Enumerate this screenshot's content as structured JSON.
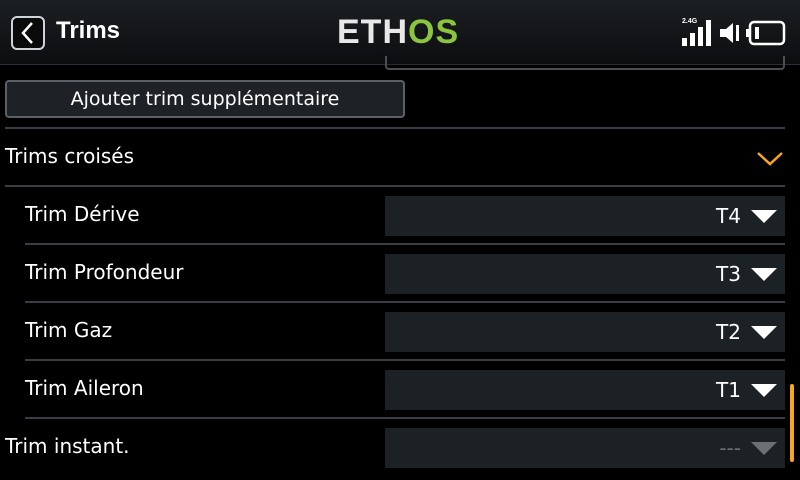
{
  "header": {
    "back_icon": "chevron-left-icon",
    "title": "Trims",
    "logo_left": "ETH",
    "logo_right": "OS",
    "signal_label": "2.4G",
    "icons": [
      "signal-bars-icon",
      "speaker-icon",
      "battery-icon"
    ]
  },
  "add_trim_label": "Ajouter trim supplémentaire",
  "cross_trims": {
    "title": "Trims croisés",
    "toggle_icon": "chevron-down-icon",
    "accent": "#f6a623",
    "rows": [
      {
        "label": "Trim Dérive",
        "value": "T4"
      },
      {
        "label": "Trim Profondeur",
        "value": "T3"
      },
      {
        "label": "Trim Gaz",
        "value": "T2"
      },
      {
        "label": "Trim Aileron",
        "value": "T1"
      }
    ]
  },
  "instant_trim": {
    "label": "Trim instant.",
    "value": "---"
  },
  "colors": {
    "logo_accent": "#8bc53f",
    "field_bg": "#1c2126"
  }
}
